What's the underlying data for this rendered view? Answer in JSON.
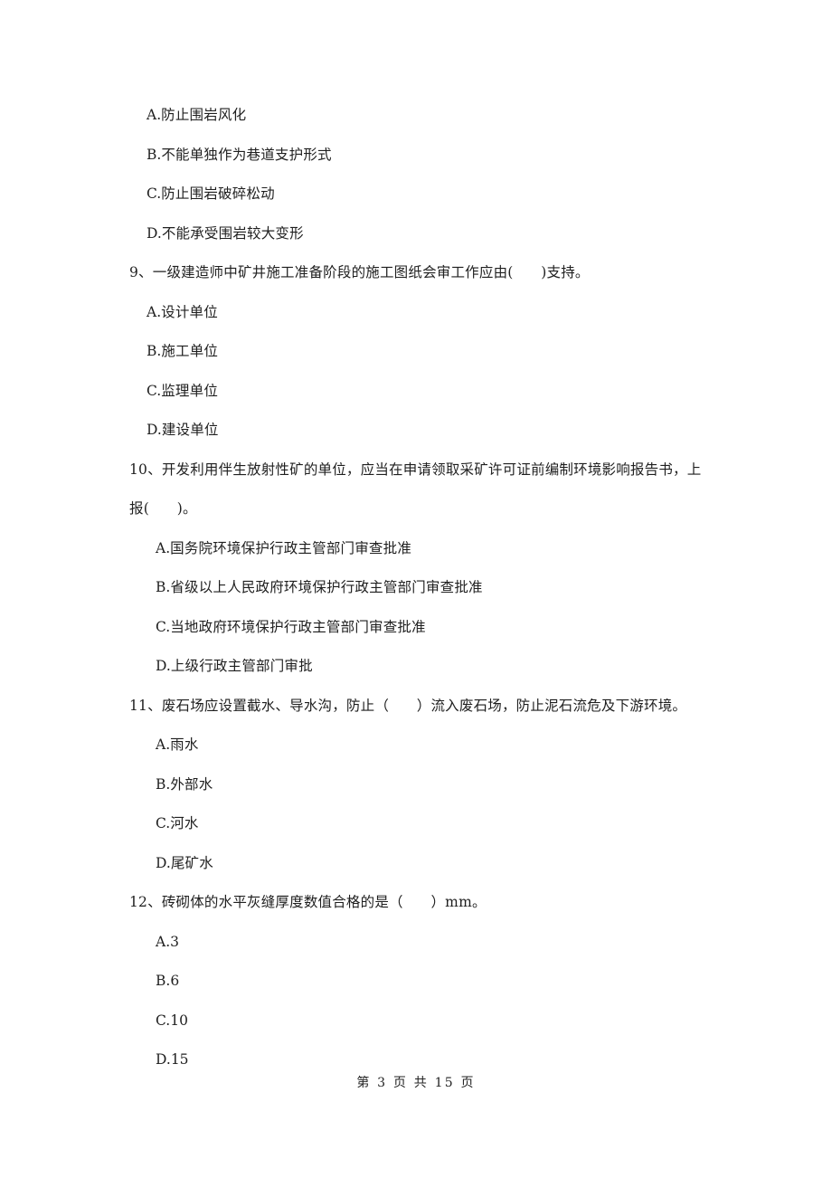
{
  "document": {
    "type": "exam-paper",
    "background_color": "#ffffff",
    "text_color": "#1f1f1f"
  },
  "questions": [
    {
      "number": "",
      "stem_lines": [],
      "options": [
        {
          "letter": "A.",
          "text": "防止围岩风化"
        },
        {
          "letter": "B.",
          "text": "不能单独作为巷道支护形式"
        },
        {
          "letter": "C.",
          "text": "防止围岩破碎松动"
        },
        {
          "letter": "D.",
          "text": "不能承受围岩较大变形"
        }
      ],
      "option_indent": "normal"
    },
    {
      "number": "9、",
      "stem_lines": [
        "9、一级建造师中矿井施工准备阶段的施工图纸会审工作应由(      )支持。"
      ],
      "options": [
        {
          "letter": "A.",
          "text": "设计单位"
        },
        {
          "letter": "B.",
          "text": "施工单位"
        },
        {
          "letter": "C.",
          "text": "监理单位"
        },
        {
          "letter": "D.",
          "text": "建设单位"
        }
      ],
      "option_indent": "normal"
    },
    {
      "number": "10、",
      "stem_lines": [
        "10、开发利用伴生放射性矿的单位，应当在申请领取采矿许可证前编制环境影响报告书，上",
        "报(      )。"
      ],
      "options": [
        {
          "letter": "A.",
          "text": "国务院环境保护行政主管部门审查批准"
        },
        {
          "letter": "B.",
          "text": "省级以上人民政府环境保护行政主管部门审查批准"
        },
        {
          "letter": "C.",
          "text": "当地政府环境保护行政主管部门审查批准"
        },
        {
          "letter": "D.",
          "text": "上级行政主管部门审批"
        }
      ],
      "option_indent": "deep"
    },
    {
      "number": "11、",
      "stem_lines": [
        "11、废石场应设置截水、导水沟，防止（      ）流入废石场，防止泥石流危及下游环境。"
      ],
      "options": [
        {
          "letter": "A.",
          "text": "雨水"
        },
        {
          "letter": "B.",
          "text": "外部水"
        },
        {
          "letter": "C.",
          "text": "河水"
        },
        {
          "letter": "D.",
          "text": "尾矿水"
        }
      ],
      "option_indent": "deep"
    },
    {
      "number": "12、",
      "stem_lines": [
        "12、砖砌体的水平灰缝厚度数值合格的是（      ）mm。"
      ],
      "options": [
        {
          "letter": "A.",
          "text": "3"
        },
        {
          "letter": "B.",
          "text": "6"
        },
        {
          "letter": "C.",
          "text": "10"
        },
        {
          "letter": "D.",
          "text": "15"
        }
      ],
      "option_indent": "deep"
    }
  ],
  "footer": {
    "text": "第 3 页 共 15 页",
    "page_number": "3",
    "total_pages": "15"
  }
}
